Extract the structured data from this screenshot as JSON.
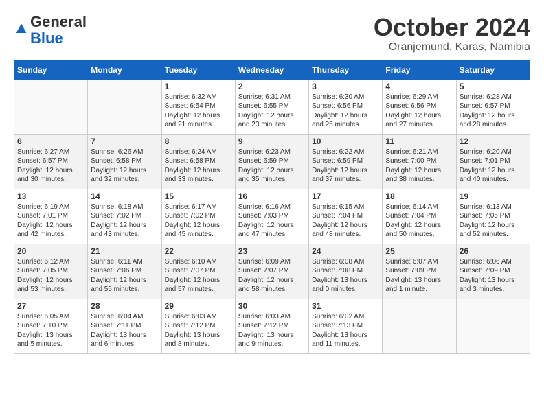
{
  "logo": {
    "general": "General",
    "blue": "Blue"
  },
  "title": "October 2024",
  "subtitle": "Oranjemund, Karas, Namibia",
  "days_of_week": [
    "Sunday",
    "Monday",
    "Tuesday",
    "Wednesday",
    "Thursday",
    "Friday",
    "Saturday"
  ],
  "weeks": [
    [
      {
        "day": null,
        "info": null
      },
      {
        "day": null,
        "info": null
      },
      {
        "day": "1",
        "info": "Sunrise: 6:32 AM\nSunset: 6:54 PM\nDaylight: 12 hours and 21 minutes."
      },
      {
        "day": "2",
        "info": "Sunrise: 6:31 AM\nSunset: 6:55 PM\nDaylight: 12 hours and 23 minutes."
      },
      {
        "day": "3",
        "info": "Sunrise: 6:30 AM\nSunset: 6:56 PM\nDaylight: 12 hours and 25 minutes."
      },
      {
        "day": "4",
        "info": "Sunrise: 6:29 AM\nSunset: 6:56 PM\nDaylight: 12 hours and 27 minutes."
      },
      {
        "day": "5",
        "info": "Sunrise: 6:28 AM\nSunset: 6:57 PM\nDaylight: 12 hours and 28 minutes."
      }
    ],
    [
      {
        "day": "6",
        "info": "Sunrise: 6:27 AM\nSunset: 6:57 PM\nDaylight: 12 hours and 30 minutes."
      },
      {
        "day": "7",
        "info": "Sunrise: 6:26 AM\nSunset: 6:58 PM\nDaylight: 12 hours and 32 minutes."
      },
      {
        "day": "8",
        "info": "Sunrise: 6:24 AM\nSunset: 6:58 PM\nDaylight: 12 hours and 33 minutes."
      },
      {
        "day": "9",
        "info": "Sunrise: 6:23 AM\nSunset: 6:59 PM\nDaylight: 12 hours and 35 minutes."
      },
      {
        "day": "10",
        "info": "Sunrise: 6:22 AM\nSunset: 6:59 PM\nDaylight: 12 hours and 37 minutes."
      },
      {
        "day": "11",
        "info": "Sunrise: 6:21 AM\nSunset: 7:00 PM\nDaylight: 12 hours and 38 minutes."
      },
      {
        "day": "12",
        "info": "Sunrise: 6:20 AM\nSunset: 7:01 PM\nDaylight: 12 hours and 40 minutes."
      }
    ],
    [
      {
        "day": "13",
        "info": "Sunrise: 6:19 AM\nSunset: 7:01 PM\nDaylight: 12 hours and 42 minutes."
      },
      {
        "day": "14",
        "info": "Sunrise: 6:18 AM\nSunset: 7:02 PM\nDaylight: 12 hours and 43 minutes."
      },
      {
        "day": "15",
        "info": "Sunrise: 6:17 AM\nSunset: 7:02 PM\nDaylight: 12 hours and 45 minutes."
      },
      {
        "day": "16",
        "info": "Sunrise: 6:16 AM\nSunset: 7:03 PM\nDaylight: 12 hours and 47 minutes."
      },
      {
        "day": "17",
        "info": "Sunrise: 6:15 AM\nSunset: 7:04 PM\nDaylight: 12 hours and 48 minutes."
      },
      {
        "day": "18",
        "info": "Sunrise: 6:14 AM\nSunset: 7:04 PM\nDaylight: 12 hours and 50 minutes."
      },
      {
        "day": "19",
        "info": "Sunrise: 6:13 AM\nSunset: 7:05 PM\nDaylight: 12 hours and 52 minutes."
      }
    ],
    [
      {
        "day": "20",
        "info": "Sunrise: 6:12 AM\nSunset: 7:05 PM\nDaylight: 12 hours and 53 minutes."
      },
      {
        "day": "21",
        "info": "Sunrise: 6:11 AM\nSunset: 7:06 PM\nDaylight: 12 hours and 55 minutes."
      },
      {
        "day": "22",
        "info": "Sunrise: 6:10 AM\nSunset: 7:07 PM\nDaylight: 12 hours and 57 minutes."
      },
      {
        "day": "23",
        "info": "Sunrise: 6:09 AM\nSunset: 7:07 PM\nDaylight: 12 hours and 58 minutes."
      },
      {
        "day": "24",
        "info": "Sunrise: 6:08 AM\nSunset: 7:08 PM\nDaylight: 13 hours and 0 minutes."
      },
      {
        "day": "25",
        "info": "Sunrise: 6:07 AM\nSunset: 7:09 PM\nDaylight: 13 hours and 1 minute."
      },
      {
        "day": "26",
        "info": "Sunrise: 6:06 AM\nSunset: 7:09 PM\nDaylight: 13 hours and 3 minutes."
      }
    ],
    [
      {
        "day": "27",
        "info": "Sunrise: 6:05 AM\nSunset: 7:10 PM\nDaylight: 13 hours and 5 minutes."
      },
      {
        "day": "28",
        "info": "Sunrise: 6:04 AM\nSunset: 7:11 PM\nDaylight: 13 hours and 6 minutes."
      },
      {
        "day": "29",
        "info": "Sunrise: 6:03 AM\nSunset: 7:12 PM\nDaylight: 13 hours and 8 minutes."
      },
      {
        "day": "30",
        "info": "Sunrise: 6:03 AM\nSunset: 7:12 PM\nDaylight: 13 hours and 9 minutes."
      },
      {
        "day": "31",
        "info": "Sunrise: 6:02 AM\nSunset: 7:13 PM\nDaylight: 13 hours and 11 minutes."
      },
      {
        "day": null,
        "info": null
      },
      {
        "day": null,
        "info": null
      }
    ]
  ]
}
